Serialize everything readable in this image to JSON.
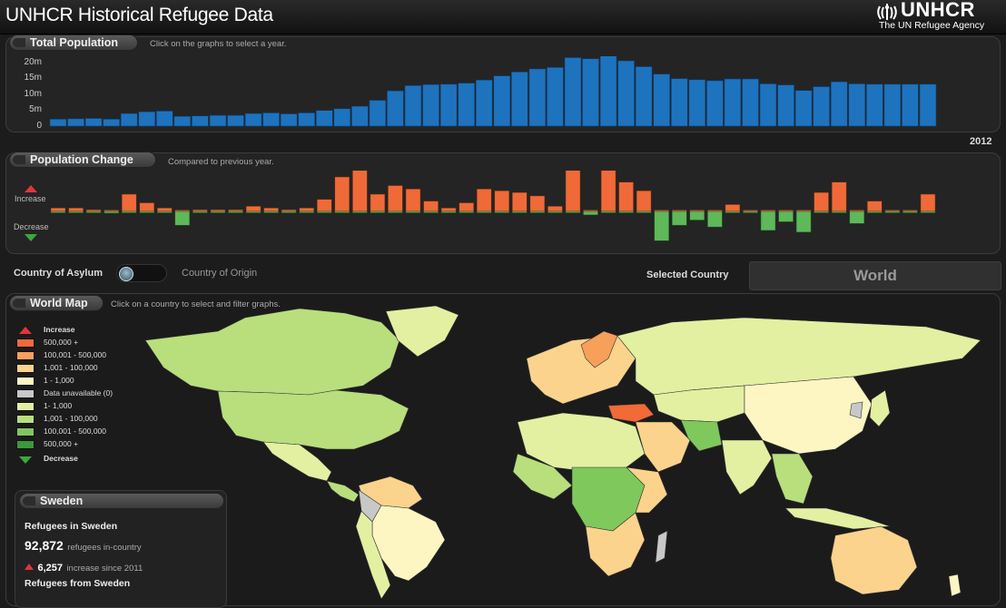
{
  "app": {
    "title": "UNHCR Historical Refugee Data"
  },
  "logo": {
    "name": "UNHCR",
    "subtitle": "The UN Refugee Agency"
  },
  "total_population": {
    "tab_label": "Total Population",
    "hint": "Click on the graphs to select a year.",
    "y_ticks": [
      "20m",
      "15m",
      "10m",
      "5m",
      "0"
    ],
    "selected_year_label": "2012"
  },
  "population_change": {
    "tab_label": "Population Change",
    "hint": "Compared to previous year.",
    "increase_label": "Increase",
    "decrease_label": "Decrease"
  },
  "controls": {
    "asylum_label": "Country of Asylum",
    "origin_label": "Country of Origin",
    "selected_country_label": "Selected Country",
    "selected_country_value": "World"
  },
  "world_map": {
    "tab_label": "World Map",
    "hint": "Click on a country to select and filter graphs."
  },
  "legend": {
    "increase_title": "Increase",
    "decrease_title": "Decrease",
    "items": [
      {
        "label": "500,000 +",
        "color": "#f26a35"
      },
      {
        "label": "100,001 - 500,000",
        "color": "#f7a05a"
      },
      {
        "label": "1,001 - 100,000",
        "color": "#fcd38c"
      },
      {
        "label": "1 - 1,000",
        "color": "#fdf6c3"
      },
      {
        "label": "Data unavailable (0)",
        "color": "#c8c8c8"
      },
      {
        "label": "1- 1,000",
        "color": "#e3f0a2"
      },
      {
        "label": "1,001 - 100,000",
        "color": "#b8df7c"
      },
      {
        "label": "100,001 - 500,000",
        "color": "#7fc85c"
      },
      {
        "label": "500,000 +",
        "color": "#3a9a3a"
      }
    ]
  },
  "info_panel": {
    "tab_label": "Sweden",
    "refugees_in_heading": "Refugees in Sweden",
    "in_country_value": "92,872",
    "in_country_text": "refugees in-country",
    "increase_value": "6,257",
    "increase_text": "increase since 2011",
    "refugees_from_heading": "Refugees from Sweden"
  },
  "colors": {
    "bar_blue": "#1e73be",
    "increase": "#ef6a38",
    "decrease": "#5fb85a"
  },
  "chart_data": [
    {
      "type": "bar",
      "unit": "millions",
      "ylim": [
        0,
        20
      ],
      "values": [
        2.0,
        2.1,
        2.2,
        2.0,
        3.6,
        4.1,
        4.3,
        2.8,
        2.9,
        3.1,
        3.1,
        3.6,
        3.8,
        3.5,
        3.8,
        4.5,
        5.0,
        5.7,
        7.4,
        10.1,
        11.6,
        11.9,
        12.0,
        12.3,
        13.2,
        14.4,
        15.5,
        16.4,
        16.8,
        19.6,
        19.3,
        20.1,
        18.7,
        17.0,
        14.9,
        13.6,
        13.3,
        13.0,
        13.5,
        13.5,
        12.1,
        11.8,
        10.2,
        11.3,
        12.7,
        12.1,
        12.0,
        12.0,
        12.0,
        12.0
      ]
    },
    {
      "type": "bar",
      "unit": "relative change",
      "values": [
        0.1,
        0.1,
        0.05,
        -0.05,
        0.5,
        0.25,
        0.1,
        -0.4,
        0.05,
        0.05,
        0.05,
        0.15,
        0.1,
        0.05,
        0.1,
        0.35,
        1.0,
        1.25,
        0.5,
        0.75,
        0.65,
        0.3,
        0.1,
        0.25,
        0.65,
        0.6,
        0.55,
        0.45,
        0.15,
        1.2,
        -0.1,
        1.25,
        0.85,
        0.6,
        -0.85,
        -0.4,
        -0.25,
        -0.45,
        0.2,
        0.0,
        -0.55,
        -0.3,
        -0.6,
        0.55,
        0.85,
        -0.35,
        0.3,
        0.0,
        0.0,
        0.5
      ]
    }
  ]
}
